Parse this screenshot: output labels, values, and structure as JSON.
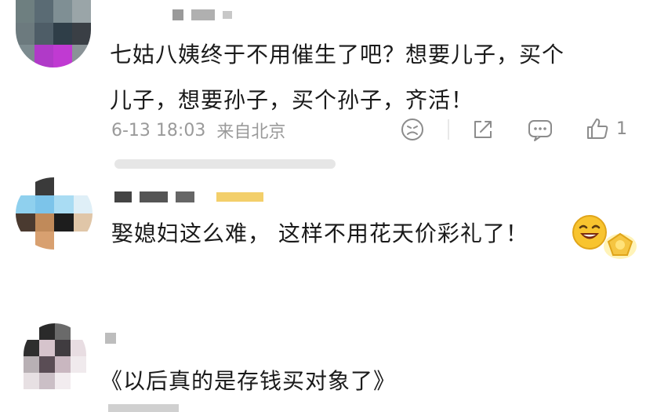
{
  "comments": [
    {
      "text_lines": [
        "七姑八姨终于不用催生了吧？想要儿子，买个",
        "儿子，想要孙子，买个孙子，齐活！"
      ],
      "time": "6-13 18:03",
      "location": "来自北京",
      "like_count": "1",
      "icons": [
        "dislike-face-icon",
        "share-icon",
        "comment-icon",
        "like-thumb-icon"
      ]
    },
    {
      "text": "娶媳妇这么难， 这样不用花天价彩礼了！",
      "emojis": [
        "laughing-face-emoji",
        "gold-medal-emoji"
      ]
    },
    {
      "text": "《以后真的是存钱买对象了》"
    }
  ],
  "colors": {
    "text": "#1a1a1a",
    "meta": "#9a9a9a",
    "icon": "#8c8c8c",
    "badge": "#f5c542"
  }
}
